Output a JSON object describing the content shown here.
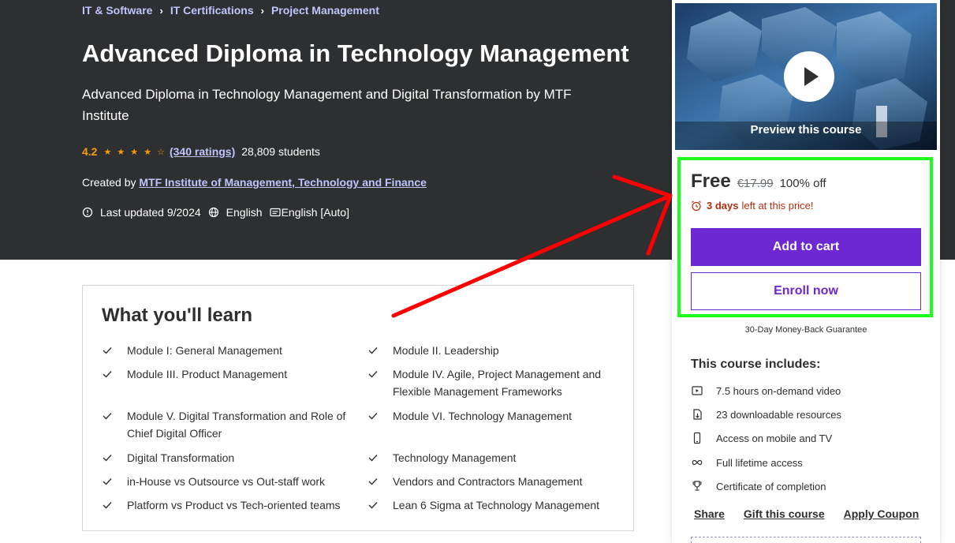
{
  "breadcrumb": [
    "IT & Software",
    "IT Certifications",
    "Project Management"
  ],
  "course": {
    "title": "Advanced Diploma in Technology Management",
    "subtitle": "Advanced Diploma in Technology Management and Digital Transformation by MTF Institute",
    "rating": "4.2",
    "stars": "★ ★ ★ ★ ☆",
    "rating_count": "(340 ratings)",
    "students": "28,809 students",
    "created_by_label": "Created by",
    "instructor": "MTF Institute of Management, Technology and Finance",
    "last_updated": "Last updated 9/2024",
    "language": "English",
    "captions": "English [Auto]"
  },
  "learn": {
    "title": "What you'll learn",
    "items": [
      "Module I: General Management",
      "Module II. Leadership",
      "Module III. Product Management",
      "Module IV. Agile, Project Management and Flexible Management Frameworks",
      "Module V. Digital Transformation and Role of Chief Digital Officer",
      "Module VI. Technology Management",
      "Digital Transformation",
      "Technology Management",
      "in-House vs Outsource vs Out-staff work",
      "Vendors and Contractors Management",
      "Platform vs Product vs Tech-oriented teams",
      "Lean 6 Sigma at Technology Management"
    ]
  },
  "sidebar": {
    "preview_label": "Preview this course",
    "price": "Free",
    "old_price": "€17.99",
    "discount": "100% off",
    "timer_bold": "3 days",
    "timer_rest": "left at this price!",
    "add_to_cart": "Add to cart",
    "enroll_now": "Enroll now",
    "guarantee": "30-Day Money-Back Guarantee",
    "includes_title": "This course includes:",
    "includes": [
      {
        "icon": "video-icon",
        "text": "7.5 hours on-demand video"
      },
      {
        "icon": "download-file-icon",
        "text": "23 downloadable resources"
      },
      {
        "icon": "mobile-icon",
        "text": "Access on mobile and TV"
      },
      {
        "icon": "infinity-icon",
        "text": "Full lifetime access"
      },
      {
        "icon": "trophy-icon",
        "text": "Certificate of completion"
      }
    ],
    "links": [
      "Share",
      "Gift this course",
      "Apply Coupon"
    ]
  },
  "colors": {
    "hero_bg": "#2d2f31",
    "accent": "#6d28d2",
    "link_light": "#c0c4fc",
    "star": "#f69c08",
    "timer": "#b32d0f",
    "highlight": "#1cff1c",
    "annotation_arrow": "#ff0000"
  }
}
